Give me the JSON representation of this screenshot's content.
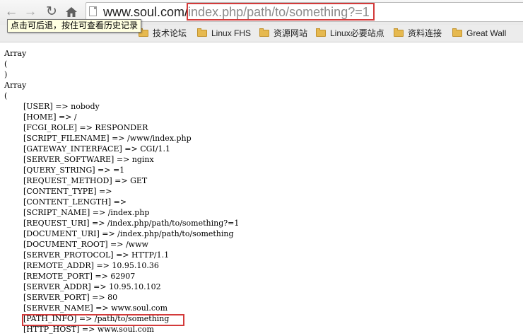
{
  "browser": {
    "url_host": "www.soul.com/",
    "url_path": "index.php/path/to/something?=1",
    "tooltip": "点击可后退，按住可查看历史记录",
    "icons": {
      "back": "back-arrow-icon",
      "forward": "forward-arrow-icon",
      "reload": "reload-icon",
      "home": "home-icon",
      "page": "page-icon",
      "folder": "folder-icon"
    },
    "bookmarks": [
      {
        "label": "技术论坛"
      },
      {
        "label": "Linux FHS"
      },
      {
        "label": "资源网站"
      },
      {
        "label": "Linux必要站点"
      },
      {
        "label": "资料连接"
      },
      {
        "label": "Great Wall"
      }
    ]
  },
  "output": {
    "array1": [
      "Array",
      "(",
      ")"
    ],
    "array2_open": [
      "Array",
      "("
    ],
    "entries": [
      "[USER] => nobody",
      "[HOME] => /",
      "[FCGI_ROLE] => RESPONDER",
      "[SCRIPT_FILENAME] => /www/index.php",
      "[GATEWAY_INTERFACE] => CGI/1.1",
      "[SERVER_SOFTWARE] => nginx",
      "[QUERY_STRING] => =1",
      "[REQUEST_METHOD] => GET",
      "[CONTENT_TYPE] =>",
      "[CONTENT_LENGTH] =>",
      "[SCRIPT_NAME] => /index.php",
      "[REQUEST_URI] => /index.php/path/to/something?=1",
      "[DOCUMENT_URI] => /index.php/path/to/something",
      "[DOCUMENT_ROOT] => /www",
      "[SERVER_PROTOCOL] => HTTP/1.1",
      "[REMOTE_ADDR] => 10.95.10.36",
      "[REMOTE_PORT] => 62907",
      "[SERVER_ADDR] => 10.95.10.102",
      "[SERVER_PORT] => 80",
      "[SERVER_NAME] => www.soul.com",
      "[PATH_INFO] => /path/to/something",
      "[HTTP_HOST] => www.soul.com"
    ]
  },
  "colors": {
    "highlight_border": "#d33a3a",
    "tooltip_bg": "#ffffe1"
  }
}
